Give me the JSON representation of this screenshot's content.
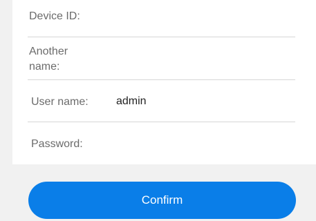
{
  "form": {
    "device_id_label": "Device ID:",
    "another_name_label_line1": "Another",
    "another_name_label_line2": "name:",
    "user_name_label": "User name:",
    "user_name_value": "admin",
    "password_label": "Password:"
  },
  "actions": {
    "confirm_label": "Confirm"
  },
  "colors": {
    "accent": "#0a7ee8",
    "background": "#f1f1f1",
    "card": "#ffffff",
    "divider": "#d6d6d6",
    "label_text": "#6b6b6b"
  }
}
